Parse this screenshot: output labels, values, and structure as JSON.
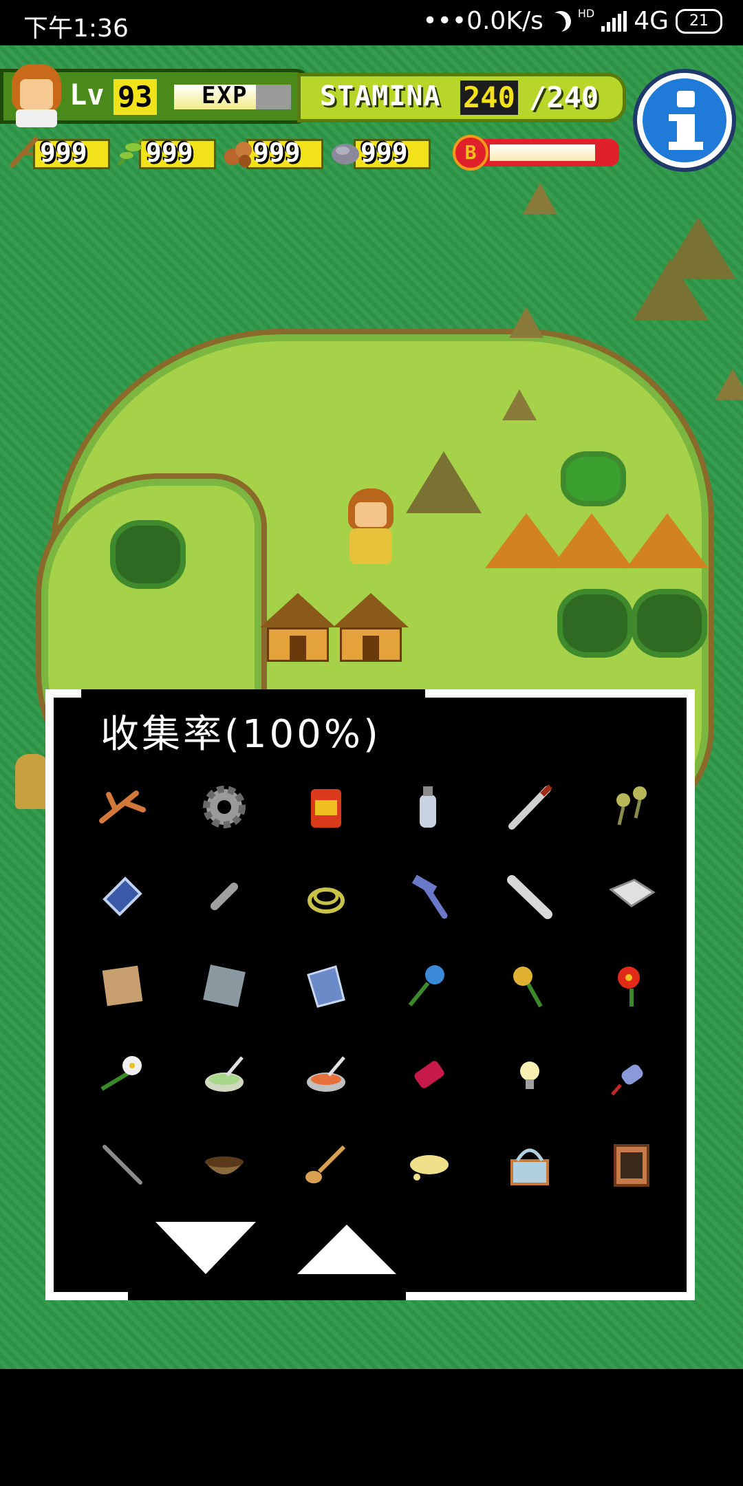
{
  "status_bar": {
    "time": "下午1:36",
    "network_speed": "•••0.0K/s",
    "network_type": "4G",
    "hd_label": "HD",
    "battery": "21"
  },
  "hud": {
    "level_label": "Lv",
    "level": "93",
    "exp_label": "EXP",
    "exp_progress": 0.7,
    "stamina_label": "STAMINA",
    "stamina_current": "240",
    "stamina_max": "/240",
    "resources": [
      {
        "icon": "wood-branch-icon",
        "value": "999"
      },
      {
        "icon": "leaf-herb-icon",
        "value": "999"
      },
      {
        "icon": "nuts-icon",
        "value": "999"
      },
      {
        "icon": "stone-icon",
        "value": "999"
      }
    ],
    "bonus_label": "B",
    "bonus_progress": 0.9
  },
  "collection": {
    "title": "收集率(100%)",
    "items": [
      {
        "icon": "branch-icon",
        "color": "#d2783a"
      },
      {
        "icon": "gear-icon",
        "color": "#9a9a9a"
      },
      {
        "icon": "fuel-can-icon",
        "color": "#d83a1a"
      },
      {
        "icon": "bottle-icon",
        "color": "#c8d2e0"
      },
      {
        "icon": "spark-plug-icon",
        "color": "#d0d0d0"
      },
      {
        "icon": "maracas-icon",
        "color": "#b8b85a"
      },
      {
        "icon": "glass-panel-icon",
        "color": "#3a5aa8"
      },
      {
        "icon": "pipe-icon",
        "color": "#a0a0a0"
      },
      {
        "icon": "rope-icon",
        "color": "#c8c24a"
      },
      {
        "icon": "hammer-icon",
        "color": "#6a78c8"
      },
      {
        "icon": "tube-icon",
        "color": "#d8d8d8"
      },
      {
        "icon": "paper-icon",
        "color": "#e0e0e0"
      },
      {
        "icon": "cloth-icon",
        "color": "#c8a070"
      },
      {
        "icon": "metal-sheet-icon",
        "color": "#8a9aa0"
      },
      {
        "icon": "blue-sheet-icon",
        "color": "#6a8ac8"
      },
      {
        "icon": "blue-flower-icon",
        "color": "#3a8ad8"
      },
      {
        "icon": "yellow-flower-icon",
        "color": "#e0b030"
      },
      {
        "icon": "red-flower-icon",
        "color": "#e02a1a"
      },
      {
        "icon": "white-flower-icon",
        "color": "#f0f0f0"
      },
      {
        "icon": "green-paste-bowl-icon",
        "color": "#a8d88a"
      },
      {
        "icon": "orange-paste-bowl-icon",
        "color": "#e8703a"
      },
      {
        "icon": "battery-icon",
        "color": "#c81a4a"
      },
      {
        "icon": "light-bulb-icon",
        "color": "#f8f0b0"
      },
      {
        "icon": "plug-icon",
        "color": "#8a9ad8"
      },
      {
        "icon": "stick-icon",
        "color": "#8a8a8a"
      },
      {
        "icon": "wooden-bowl-icon",
        "color": "#8a6a3a"
      },
      {
        "icon": "wooden-spoon-icon",
        "color": "#d8a050"
      },
      {
        "icon": "yellow-slime-icon",
        "color": "#f0e08a"
      },
      {
        "icon": "basket-icon",
        "color": "#b0d0e0"
      },
      {
        "icon": "cabinet-icon",
        "color": "#c87a4a"
      }
    ]
  },
  "colors": {
    "sea": "#2f9a4a",
    "island": "#a6d24a",
    "hud_green": "#4a8a1a",
    "stamina_yellow": "#b8d62a",
    "info_blue": "#1f7ad8"
  }
}
